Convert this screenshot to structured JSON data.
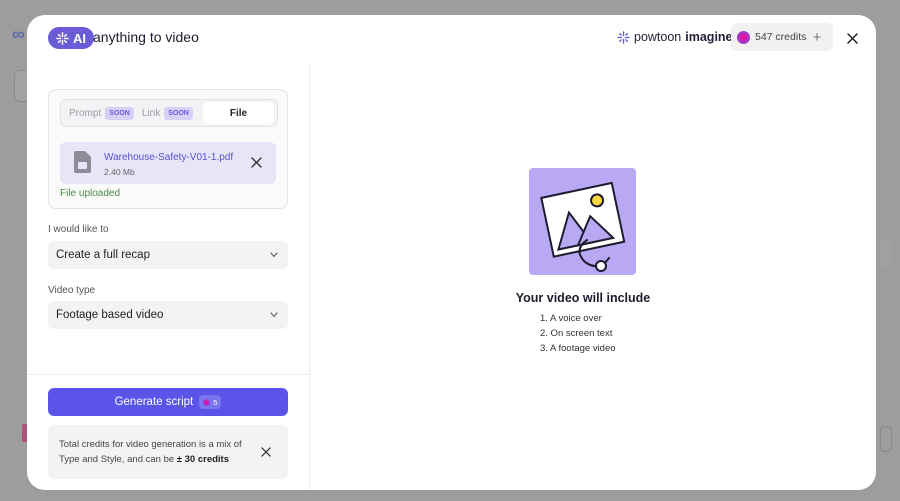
{
  "header": {
    "ai_badge": "AI",
    "title": "anything to video",
    "powtoon_prefix": "powtoon",
    "powtoon_suffix": "imagine",
    "credits": "547 credits",
    "plus_label": "+"
  },
  "source": {
    "tabs": [
      {
        "label": "Prompt",
        "badge": "SOON"
      },
      {
        "label": "Link",
        "badge": "SOON"
      },
      {
        "label": "File",
        "badge": ""
      }
    ],
    "file_name": "Warehouse-Safety-V01-1.pdf",
    "file_size": "2.40 Mb",
    "status": "File uploaded"
  },
  "goal": {
    "label": "I would like to",
    "value": "Create a full recap"
  },
  "video_type": {
    "label": "Video type",
    "value": "Footage based video"
  },
  "generate": {
    "label": "Generate script",
    "cost": "5"
  },
  "info": {
    "text_part1": "Total credits for video generation is a mix of Type and Style, and can be ",
    "text_bold": "± 30 credits"
  },
  "preview": {
    "title": "Your video will include",
    "items": [
      "1. A voice over",
      "2. On screen text",
      "3. A footage video"
    ]
  },
  "colors": {
    "accent": "#5b54e8",
    "ai_badge": "#6b5bd6",
    "file_bg": "#e7e6f8",
    "success": "#4e8b4a",
    "illustration_bg": "#b9a9f5"
  }
}
